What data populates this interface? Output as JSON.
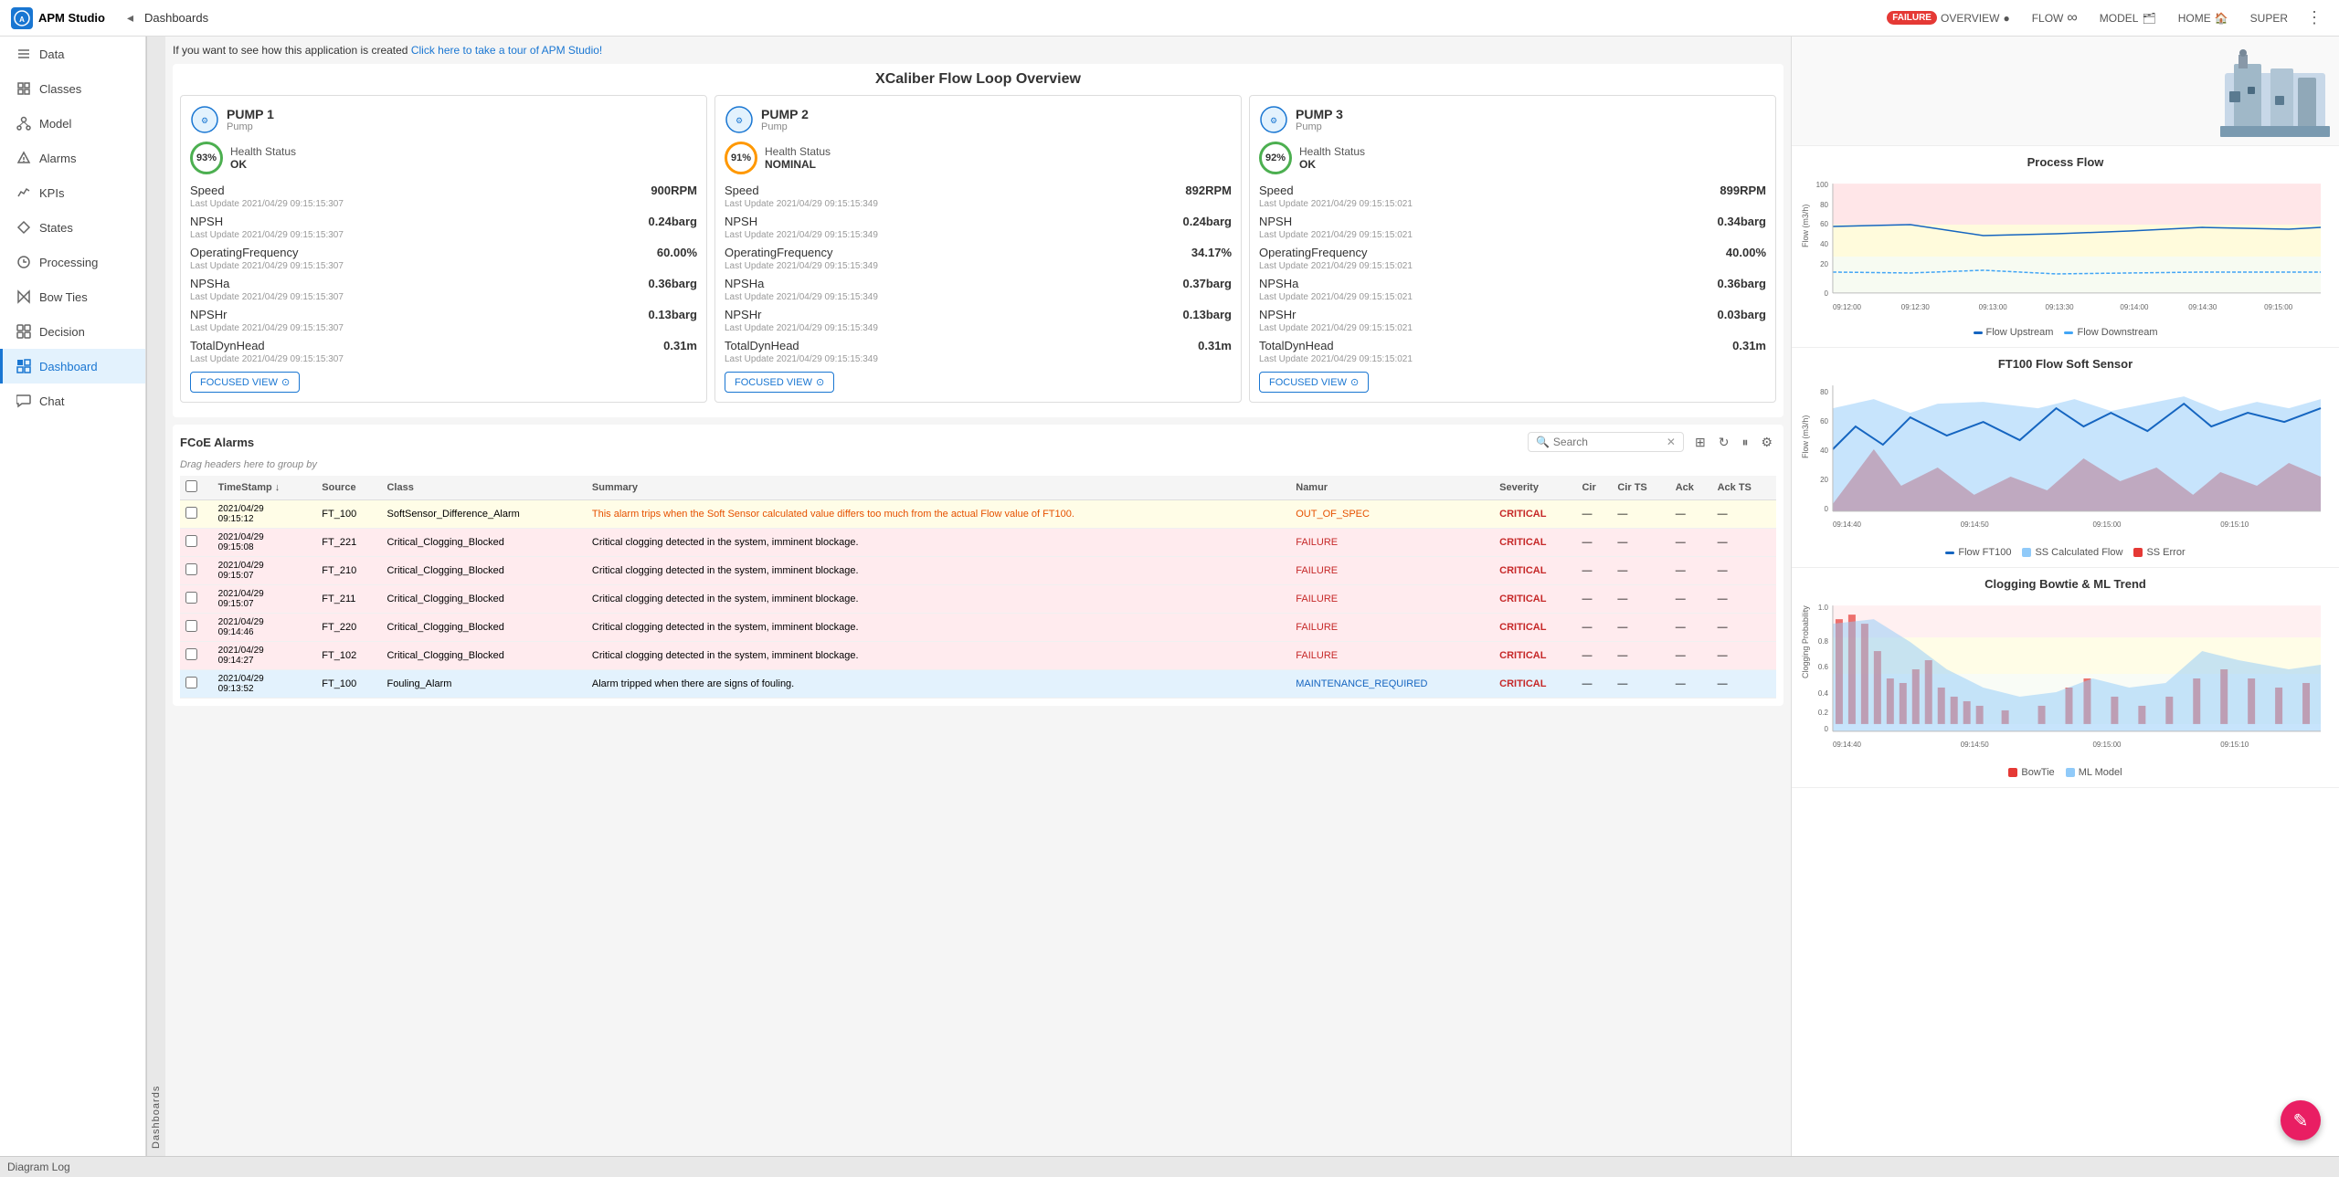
{
  "app": {
    "logo": "APM",
    "title": "APM Studio",
    "breadcrumb": "Dashboards",
    "collapse_icon": "◂"
  },
  "nav_tabs": [
    {
      "id": "overview",
      "label": "OVERVIEW",
      "icon": "circle",
      "has_badge": true,
      "badge": "FAILURE",
      "active": false
    },
    {
      "id": "flow",
      "label": "FLOW",
      "icon": "infinity",
      "active": false
    },
    {
      "id": "model",
      "label": "MODEL",
      "icon": "layer",
      "active": false
    },
    {
      "id": "home",
      "label": "HOME",
      "icon": "home",
      "active": false
    },
    {
      "id": "super",
      "label": "SUPER",
      "icon": "more",
      "active": false
    }
  ],
  "sidebar": {
    "items": [
      {
        "id": "data",
        "label": "Data",
        "icon": "data"
      },
      {
        "id": "classes",
        "label": "Classes",
        "icon": "classes"
      },
      {
        "id": "model",
        "label": "Model",
        "icon": "model"
      },
      {
        "id": "alarms",
        "label": "Alarms",
        "icon": "alarms"
      },
      {
        "id": "kpis",
        "label": "KPIs",
        "icon": "kpis"
      },
      {
        "id": "states",
        "label": "States",
        "icon": "states"
      },
      {
        "id": "processing",
        "label": "Processing",
        "icon": "processing"
      },
      {
        "id": "bowties",
        "label": "Bow Ties",
        "icon": "bowties"
      },
      {
        "id": "decision",
        "label": "Decision",
        "icon": "decision"
      },
      {
        "id": "dashboard",
        "label": "Dashboard",
        "icon": "dashboard",
        "active": true
      },
      {
        "id": "chat",
        "label": "Chat",
        "icon": "chat"
      }
    ]
  },
  "page": {
    "title": "XCaliber Flow Loop Overview",
    "info_banner": "If you want to see how this application is created",
    "info_link": "Click here to take a tour of APM Studio!",
    "diagram_log": "Diagram Log"
  },
  "pumps": [
    {
      "name": "PUMP 1",
      "type": "Pump",
      "health_pct": "93%",
      "health_status": "Health Status",
      "health_label": "OK",
      "health_color": "#4caf50",
      "speed": "900RPM",
      "npsh": "0.24barg",
      "op_freq": "60.00%",
      "npsha": "0.36barg",
      "npshr": "0.13barg",
      "total_dyn_head": "0.31m",
      "last_update": "Last Update 2021/04/29 09:15:15:307",
      "focused_btn": "FOCUSED VIEW"
    },
    {
      "name": "PUMP 2",
      "type": "Pump",
      "health_pct": "91%",
      "health_status": "Health Status",
      "health_label": "NOMINAL",
      "health_color": "#ff9800",
      "speed": "892RPM",
      "npsh": "0.24barg",
      "op_freq": "34.17%",
      "npsha": "0.37barg",
      "npshr": "0.13barg",
      "total_dyn_head": "0.31m",
      "last_update": "Last Update 2021/04/29 09:15:15:349",
      "focused_btn": "FOCUSED VIEW"
    },
    {
      "name": "PUMP 3",
      "type": "Pump",
      "health_pct": "92%",
      "health_status": "Health Status",
      "health_label": "OK",
      "health_color": "#4caf50",
      "speed": "899RPM",
      "npsh": "0.34barg",
      "op_freq": "40.00%",
      "npsha": "0.36barg",
      "npshr": "0.03barg",
      "total_dyn_head": "0.31m",
      "last_update": "Last Update 2021/04/29 09:15:15:021",
      "focused_btn": "FOCUSED VIEW"
    }
  ],
  "alarms": {
    "title": "FCoE Alarms",
    "search_placeholder": "Search",
    "drag_hint": "Drag headers here to group by",
    "columns": [
      "TimeStamp ↓",
      "Source",
      "Class",
      "Summary",
      "Namur",
      "Severity",
      "Cir",
      "Cir TS",
      "Ack",
      "Ack TS"
    ],
    "rows": [
      {
        "type": "yellow",
        "timestamp": "2021/04/29 09:15:12",
        "source": "FT_100",
        "class": "SoftSensor_Difference_Alarm",
        "summary": "This alarm trips when the Soft Sensor calculated value differs too much from the actual Flow value of FT100.",
        "namur": "OUT_OF_SPEC",
        "severity": "CRITICAL",
        "cir": "—",
        "cir_ts": "—",
        "ack": "—",
        "ack_ts": "—"
      },
      {
        "type": "red",
        "timestamp": "2021/04/29 09:15:08",
        "source": "FT_221",
        "class": "Critical_Clogging_Blocked",
        "summary": "Critical clogging detected in the system, imminent blockage.",
        "namur": "FAILURE",
        "severity": "CRITICAL",
        "cir": "—",
        "cir_ts": "—",
        "ack": "—",
        "ack_ts": "—"
      },
      {
        "type": "red",
        "timestamp": "2021/04/29 09:15:07",
        "source": "FT_210",
        "class": "Critical_Clogging_Blocked",
        "summary": "Critical clogging detected in the system, imminent blockage.",
        "namur": "FAILURE",
        "severity": "CRITICAL",
        "cir": "—",
        "cir_ts": "—",
        "ack": "—",
        "ack_ts": "—"
      },
      {
        "type": "red",
        "timestamp": "2021/04/29 09:15:07",
        "source": "FT_211",
        "class": "Critical_Clogging_Blocked",
        "summary": "Critical clogging detected in the system, imminent blockage.",
        "namur": "FAILURE",
        "severity": "CRITICAL",
        "cir": "—",
        "cir_ts": "—",
        "ack": "—",
        "ack_ts": "—"
      },
      {
        "type": "red",
        "timestamp": "2021/04/29 09:14:46",
        "source": "FT_220",
        "class": "Critical_Clogging_Blocked",
        "summary": "Critical clogging detected in the system, imminent blockage.",
        "namur": "FAILURE",
        "severity": "CRITICAL",
        "cir": "—",
        "cir_ts": "—",
        "ack": "—",
        "ack_ts": "—"
      },
      {
        "type": "red",
        "timestamp": "2021/04/29 09:14:27",
        "source": "FT_102",
        "class": "Critical_Clogging_Blocked",
        "summary": "Critical clogging detected in the system, imminent blockage.",
        "namur": "FAILURE",
        "severity": "CRITICAL",
        "cir": "—",
        "cir_ts": "—",
        "ack": "—",
        "ack_ts": "—"
      },
      {
        "type": "blue",
        "timestamp": "2021/04/29 09:13:52",
        "source": "FT_100",
        "class": "Fouling_Alarm",
        "summary": "Alarm tripped when there are signs of fouling.",
        "namur": "MAINTENANCE_REQUIRED",
        "severity": "CRITICAL",
        "cir": "—",
        "cir_ts": "—",
        "ack": "—",
        "ack_ts": "—"
      }
    ]
  },
  "charts": {
    "process_flow": {
      "title": "Process Flow",
      "y_label": "Flow (m3/h)",
      "y_max": 100,
      "x_labels": [
        "09:12:00",
        "09:12:30",
        "09:13:00",
        "09:13:30",
        "09:14:00",
        "09:14:30",
        "09:15:00"
      ],
      "legend": [
        {
          "label": "Flow Upstream",
          "color": "#1565c0"
        },
        {
          "label": "Flow Downstream",
          "color": "#1565c0",
          "style": "dashed"
        }
      ]
    },
    "ft100_soft_sensor": {
      "title": "FT100 Flow Soft Sensor",
      "y_label": "Flow (m3/h)",
      "y_max": 80,
      "x_labels": [
        "09:14:40",
        "09:14:50",
        "09:15:00",
        "09:15:10"
      ],
      "legend": [
        {
          "label": "Flow FT100",
          "color": "#1565c0"
        },
        {
          "label": "SS Calculated Flow",
          "color": "#90caf9"
        },
        {
          "label": "SS Error",
          "color": "#e53935"
        }
      ]
    },
    "clogging_bowtie": {
      "title": "Clogging Bowtie & ML Trend",
      "y_label": "Clogging Probability",
      "y_max": 1.0,
      "x_labels": [
        "09:14:40",
        "09:14:50",
        "09:15:00",
        "09:15:10"
      ],
      "legend": [
        {
          "label": "BowTie",
          "color": "#e53935"
        },
        {
          "label": "ML Model",
          "color": "#90caf9"
        }
      ]
    }
  },
  "labels": {
    "speed": "Speed",
    "npsh": "NPSH",
    "op_freq": "OperatingFrequency",
    "npsha": "NPSHa",
    "npshr": "NPSHr",
    "total_dyn_head": "TotalDynHead",
    "last_update_prefix": "Last Update"
  }
}
